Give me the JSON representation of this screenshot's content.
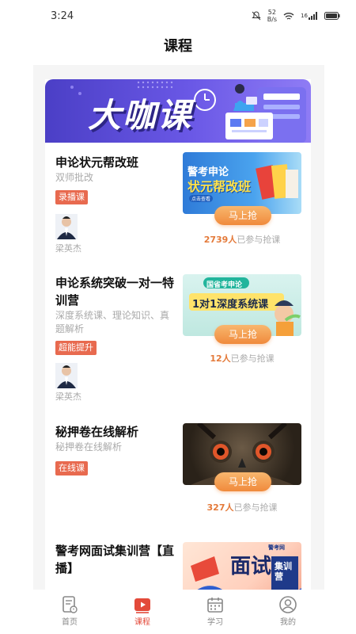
{
  "status_bar": {
    "time": "3:24",
    "net_speed_value": "52",
    "net_speed_unit": "B/s",
    "signal_label": "16"
  },
  "header": {
    "title": "课程"
  },
  "banner": {
    "title": "大咖课"
  },
  "courses": [
    {
      "title": "申论状元帮改班",
      "subtitle": "双师批改",
      "tag": "录播课",
      "teacher": "梁英杰",
      "image_line1": "警考申论",
      "image_line2": "状元帮改班",
      "image_small": "点击查看",
      "button": "马上抢",
      "count": "2739人",
      "count_suffix": "已参与抢课"
    },
    {
      "title": "申论系统突破一对一特训营",
      "subtitle": "深度系统课、理论知识、真题解析",
      "tag": "超能提升",
      "teacher": "梁英杰",
      "image_line1": "国省考申论",
      "image_line2": "1对1深度系统课",
      "button": "马上抢",
      "count": "12人",
      "count_suffix": "已参与抢课"
    },
    {
      "title": "秘押卷在线解析",
      "subtitle": "秘押卷在线解析",
      "tag": "在线课",
      "button": "马上抢",
      "count": "327人",
      "count_suffix": "已参与抢课"
    },
    {
      "title": "警考网面试集训营【直播】",
      "image_line1": "面试",
      "image_line2": "集训营",
      "image_logo": "警考网"
    }
  ],
  "tabbar": {
    "items": [
      {
        "label": "首页",
        "icon": "home-doc-icon",
        "active": false
      },
      {
        "label": "课程",
        "icon": "video-play-icon",
        "active": true
      },
      {
        "label": "学习",
        "icon": "calendar-icon",
        "active": false
      },
      {
        "label": "我的",
        "icon": "user-icon",
        "active": false
      }
    ],
    "active_color": "#e34a3a",
    "inactive_color": "#888888"
  },
  "colors": {
    "tag": "#e86a4f",
    "button": "#f08a3c",
    "banner": "#5b4ad8"
  }
}
